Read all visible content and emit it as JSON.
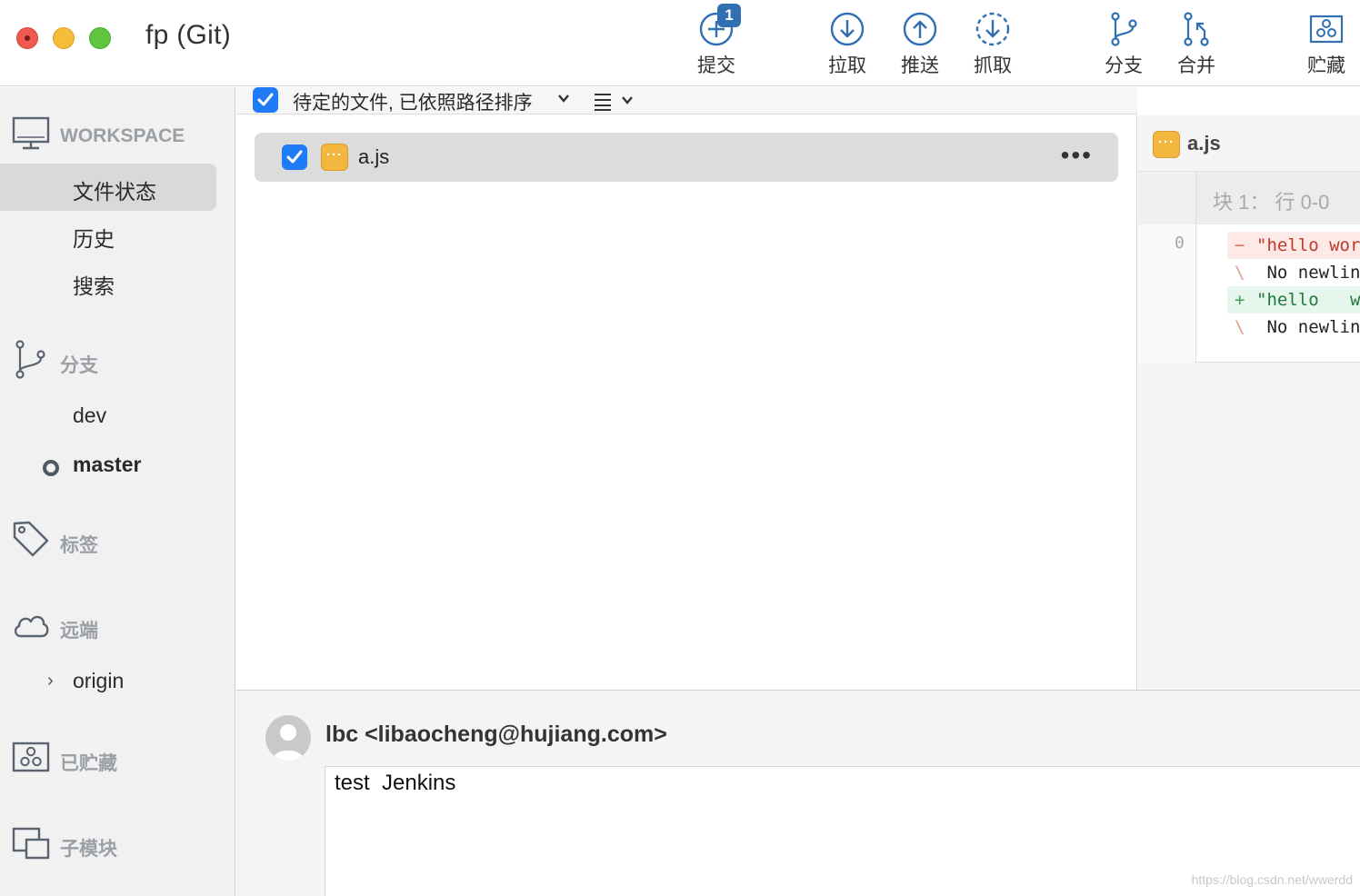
{
  "window": {
    "title": "fp (Git)"
  },
  "toolbar": {
    "commit_label": "提交",
    "commit_badge": "1",
    "pull_label": "拉取",
    "push_label": "推送",
    "fetch_label": "抓取",
    "branch_label": "分支",
    "merge_label": "合并",
    "stash_label": "贮藏"
  },
  "sidebar": {
    "workspace": {
      "header": "WORKSPACE",
      "items": [
        {
          "label": "文件状态",
          "selected": true
        },
        {
          "label": "历史"
        },
        {
          "label": "搜索"
        }
      ]
    },
    "branches": {
      "header": "分支",
      "items": [
        {
          "label": "dev"
        },
        {
          "label": "master",
          "current": true
        }
      ]
    },
    "tags": {
      "header": "标签"
    },
    "remotes": {
      "header": "远端",
      "items": [
        {
          "label": "origin"
        }
      ]
    },
    "stashes": {
      "header": "已贮藏"
    },
    "submodules": {
      "header": "子模块"
    }
  },
  "file_list": {
    "header": "待定的文件, 已依照路径排序",
    "files": [
      {
        "name": "a.js",
        "checked": true
      }
    ]
  },
  "diff": {
    "file_name": "a.js",
    "hunk_header": "块 1：  行 0-0",
    "line_number": "0",
    "lines": [
      {
        "marker": "−",
        "text": "\"hello wor",
        "kind": "del"
      },
      {
        "marker": "\\",
        "text": " No newlin",
        "kind": "ctx"
      },
      {
        "marker": "+",
        "text": "\"hello   w",
        "kind": "add"
      },
      {
        "marker": "\\",
        "text": " No newlin",
        "kind": "ctx"
      }
    ]
  },
  "commit": {
    "author": "lbc <libaocheng@hujiang.com>",
    "message": "test  Jenkins"
  },
  "watermark": "https://blog.csdn.net/wwerdd",
  "colors": {
    "accent": "#1f7cf6",
    "toolbar_icon": "#2f6fb2",
    "file_modified": "#f3b63f",
    "diff_removed": "#c0392b",
    "diff_added": "#1f7a3c",
    "sidebar_bg": "#f1f1f1"
  }
}
